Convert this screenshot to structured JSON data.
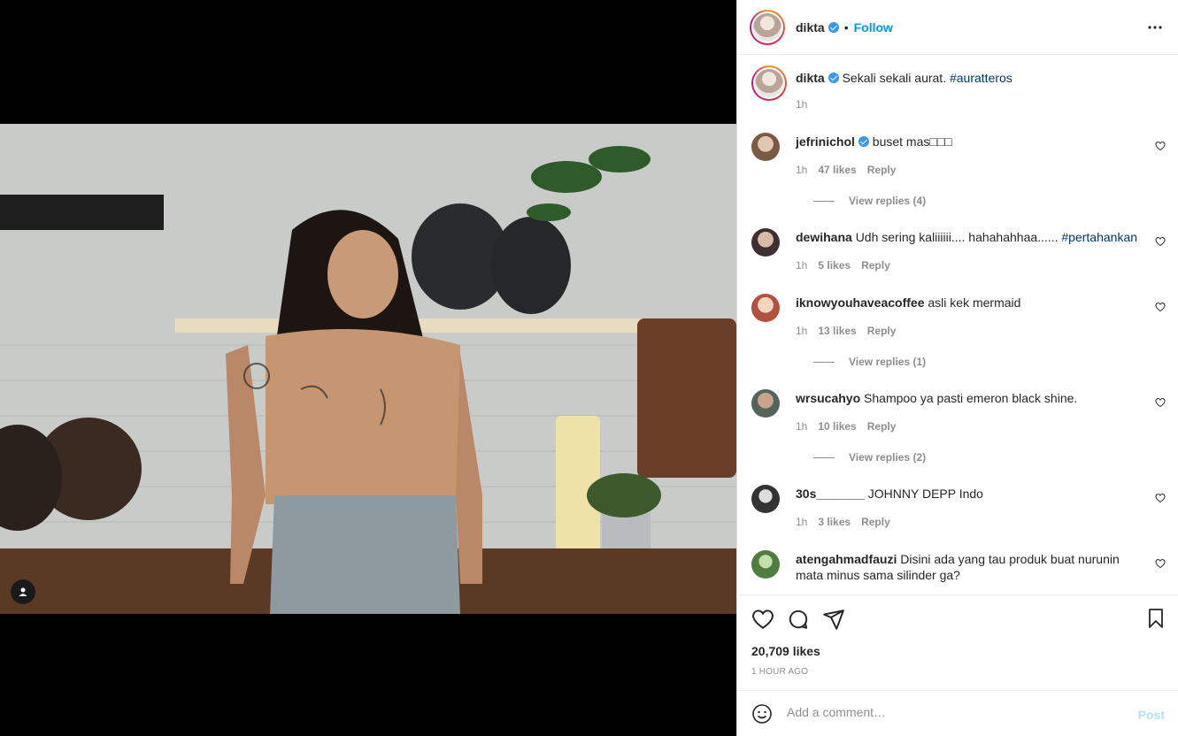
{
  "post": {
    "username": "dikta",
    "follow_label": "Follow",
    "caption_user": "dikta",
    "caption_text": "Sekali sekali aurat.",
    "caption_tag": "#auratteros",
    "caption_time": "1h"
  },
  "comments": [
    {
      "user": "jefrinichol",
      "verified": true,
      "text": "buset mas□□□",
      "time": "1h",
      "likes": "47 likes",
      "reply": "Reply",
      "view_replies": "View replies (4)",
      "avatar_color": "#a98a76"
    },
    {
      "user": "dewihana",
      "verified": false,
      "text": "Udh sering kaliiiiii.... hahahahhaa......",
      "tag": "#pertahankan",
      "time": "1h",
      "likes": "5 likes",
      "reply": "Reply",
      "avatar_color": "#5b4a4a"
    },
    {
      "user": "iknowyouhaveacoffee",
      "verified": false,
      "text": "asli kek mermaid",
      "time": "1h",
      "likes": "13 likes",
      "reply": "Reply",
      "view_replies": "View replies (1)",
      "avatar_color": "#c4614f"
    },
    {
      "user": "wrsucahyo",
      "verified": false,
      "text": "Shampoo ya pasti emeron black shine.",
      "time": "1h",
      "likes": "10 likes",
      "reply": "Reply",
      "view_replies": "View replies (2)",
      "avatar_color": "#6b7d6a"
    },
    {
      "user": "30s_______",
      "verified": false,
      "text": "JOHNNY DEPP Indo",
      "time": "1h",
      "likes": "3 likes",
      "reply": "Reply",
      "avatar_color": "#444"
    },
    {
      "user": "atengahmadfauzi",
      "verified": false,
      "text": "Disini ada yang tau produk buat nurunin mata minus sama silinder ga?",
      "avatar_color": "#5f8a4e"
    }
  ],
  "actions": {
    "likes": "20,709 likes",
    "timestamp": "1 HOUR AGO"
  },
  "comment_box": {
    "placeholder": "Add a comment…",
    "post_label": "Post"
  }
}
